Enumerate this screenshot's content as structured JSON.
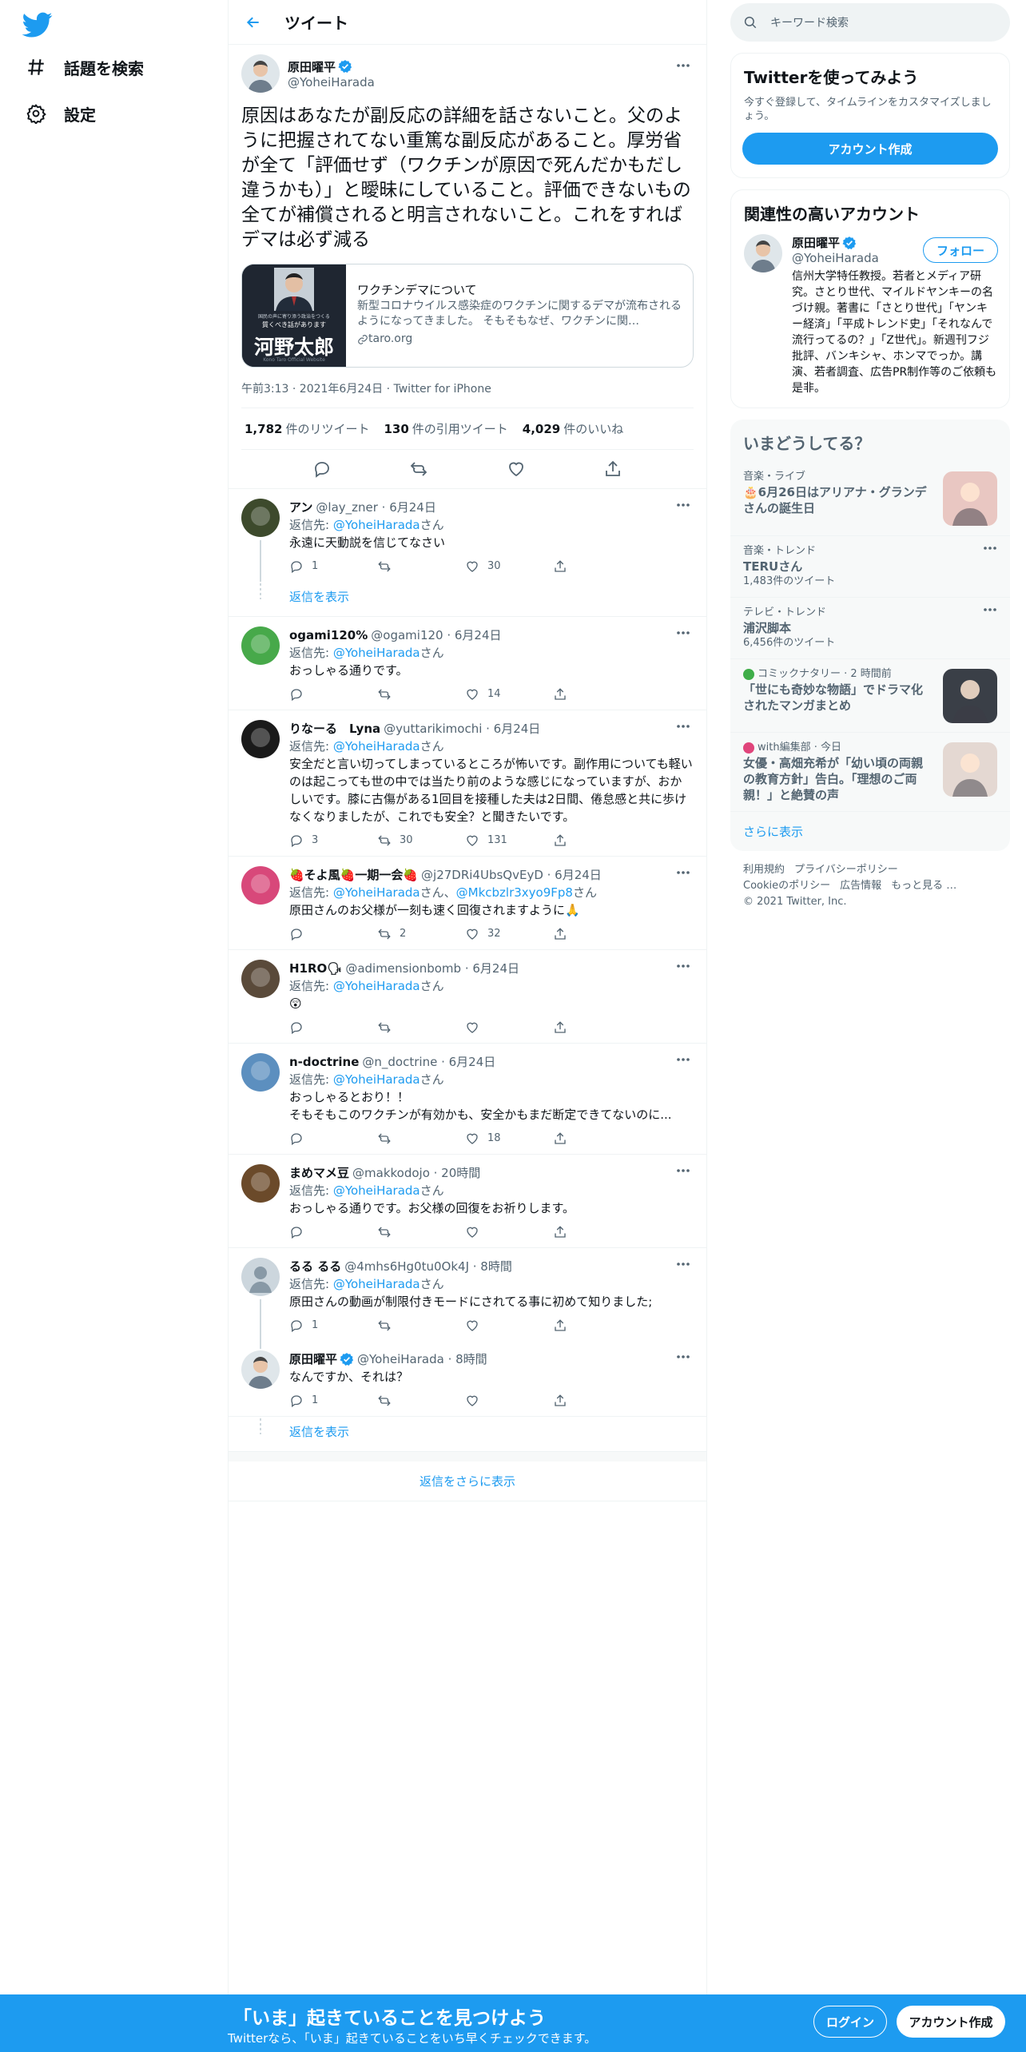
{
  "nav": {
    "logo_icon": "twitter-bird-icon",
    "items": [
      {
        "label": "話題を検索",
        "icon": "hashtag-icon"
      },
      {
        "label": "設定",
        "icon": "gear-icon"
      }
    ]
  },
  "header": {
    "title": "ツイート"
  },
  "tweet": {
    "name": "原田曜平",
    "handle": "@YoheiHarada",
    "text": "原因はあなたが副反応の詳細を話さないこと。父のように把握されてない重篤な副反応があること。厚労省が全て「評価せず（ワクチンが原因で死んだかもだし違うかも）」と曖昧にしていること。評価できないもの全てが補償されると明言されないこと。これをすればデマは必ず減る",
    "card": {
      "image_caption_small": "国民の声に寄り添う政治をつくる",
      "image_subcaption": "質くべき話があります",
      "image_name": "河野太郎",
      "image_footer": "Kono Taro Official Website",
      "title": "ワクチンデマについて",
      "description": "新型コロナウイルス感染症のワクチンに関するデマが流布されるようになってきました。 そもそもなぜ、ワクチンに関…",
      "domain": "taro.org"
    },
    "meta": "午前3:13 · 2021年6月24日 · Twitter for iPhone",
    "stats": [
      {
        "value": "1,782",
        "label": "件のリツイート"
      },
      {
        "value": "130",
        "label": "件の引用ツイート"
      },
      {
        "value": "4,029",
        "label": "件のいいね"
      }
    ]
  },
  "replies": [
    {
      "name": "アン",
      "handle": "@lay_zner · 6月24日",
      "to_prefix": "返信先: ",
      "to": [
        "@YoheiHarada"
      ],
      "to_suffix": "さん",
      "text": "永遠に天動説を信じてなさい",
      "reply_count": "1",
      "rt_count": "",
      "like_count": "30",
      "avatar_color": "#3d4a2c"
    },
    {
      "name": "ogami120%",
      "handle": "@ogami120 · 6月24日",
      "to_prefix": "返信先: ",
      "to": [
        "@YoheiHarada"
      ],
      "to_suffix": "さん",
      "text": "おっしゃる通りです。",
      "reply_count": "",
      "rt_count": "",
      "like_count": "14",
      "avatar_color": "#47a94a"
    },
    {
      "name": "りなーる　Lyna",
      "handle": "@yuttarikimochi · 6月24日",
      "to_prefix": "返信先: ",
      "to": [
        "@YoheiHarada"
      ],
      "to_suffix": "さん",
      "text": "安全だと言い切ってしまっているところが怖いです。副作用についても軽いのは起こっても世の中では当たり前のような感じになっていますが、おかしいです。膝に古傷がある1回目を接種した夫は2日間、倦怠感と共に歩けなくなりましたが、これでも安全？と聞きたいです。",
      "reply_count": "3",
      "rt_count": "30",
      "like_count": "131",
      "avatar_color": "#1a1a1a"
    },
    {
      "name": "🍓そよ風🍓一期一会🍓",
      "handle": "@j27DRi4UbsQvEyD · 6月24日",
      "to_prefix": "返信先: ",
      "to": [
        "@YoheiHarada",
        "@Mkcbzlr3xyo9Fp8"
      ],
      "to_suffix": "さん",
      "text": "原田さんのお父様が一刻も速く回復されますように🙏",
      "reply_count": "",
      "rt_count": "2",
      "like_count": "32",
      "avatar_color": "#d8487a"
    },
    {
      "name": "H1RO🗣",
      "handle": "@adimensionbomb · 6月24日",
      "to_prefix": "返信先: ",
      "to": [
        "@YoheiHarada"
      ],
      "to_suffix": "さん",
      "text": "😲",
      "reply_count": "",
      "rt_count": "",
      "like_count": "",
      "avatar_color": "#5a4a3a"
    },
    {
      "name": "n-doctrine",
      "handle": "@n_doctrine · 6月24日",
      "to_prefix": "返信先: ",
      "to": [
        "@YoheiHarada"
      ],
      "to_suffix": "さん",
      "text": "おっしゃるとおり！！\nそもそもこのワクチンが有効かも、安全かもまだ断定できてないのに...",
      "reply_count": "",
      "rt_count": "",
      "like_count": "18",
      "avatar_color": "#5c8fbf"
    },
    {
      "name": "まめマメ豆",
      "handle": "@makkodojo · 20時間",
      "to_prefix": "返信先: ",
      "to": [
        "@YoheiHarada"
      ],
      "to_suffix": "さん",
      "text": "おっしゃる通りです。お父様の回復をお祈りします。",
      "reply_count": "",
      "rt_count": "",
      "like_count": "",
      "avatar_color": "#6b4a2a"
    },
    {
      "name": "るる るる",
      "handle": "@4mhs6Hg0tu0Ok4J · 8時間",
      "to_prefix": "返信先: ",
      "to": [
        "@YoheiHarada"
      ],
      "to_suffix": "さん",
      "text": "原田さんの動画が制限付きモードにされてる事に初めて知りました;",
      "reply_count": "1",
      "rt_count": "",
      "like_count": "",
      "avatar_color": "#ccd6dd"
    },
    {
      "name": "原田曜平",
      "handle": "@YoheiHarada · 8時間",
      "to_prefix": "",
      "to": [],
      "to_suffix": "",
      "text": "なんですか、それは？",
      "reply_count": "1",
      "rt_count": "",
      "like_count": "",
      "avatar_color": "#dfe6ea"
    }
  ],
  "show_replies_label": "返信を表示",
  "show_more_replies": "返信をさらに表示",
  "right": {
    "search_placeholder": "キーワード検索",
    "signup": {
      "title": "Twitterを使ってみよう",
      "subtitle": "今すぐ登録して、タイムラインをカスタマイズしましょう。",
      "button": "アカウント作成"
    },
    "related": {
      "title": "関連性の高いアカウント",
      "name": "原田曜平",
      "handle": "@YoheiHarada",
      "follow": "フォロー",
      "bio": "信州大学特任教授。若者とメディア研究。さとり世代、マイルドヤンキーの名づけ親。著書に「さとり世代」「ヤンキー経済」「平成トレンド史」「それなんで流行ってるの？」「Z世代」。新週刊フジ批評、バンキシャ、ホンマでっか。講演、若者調査、広告PR制作等のご依頼も是非。"
    },
    "trends": {
      "title": "いまどうしてる？",
      "items": [
        {
          "category": "音楽・ライブ",
          "title": "🎂6月26日はアリアナ・グランデさんの誕生日",
          "count": "",
          "thumb": true,
          "thumb_color": "#e9c7c2"
        },
        {
          "category": "音楽・トレンド",
          "title": "TERUさん",
          "count": "1,483件のツイート",
          "thumb": false
        },
        {
          "category": "テレビ・トレンド",
          "title": "浦沢脚本",
          "count": "6,456件のツイート",
          "thumb": false
        },
        {
          "category": "コミックナタリー · 2 時間前",
          "title": "「世にも奇妙な物語」でドラマ化されたマンガまとめ",
          "count": "",
          "thumb": true,
          "thumb_color": "#3a3f47"
        },
        {
          "category": "with編集部 · 今日",
          "title": "女優・高畑充希が「幼い頃の両親の教育方針」告白。「理想のご両親！」と絶賛の声",
          "count": "",
          "thumb": true,
          "thumb_color": "#e4d8d2"
        }
      ],
      "show_more": "さらに表示"
    },
    "footer": {
      "links": [
        "利用規約",
        "プライバシーポリシー",
        "Cookieのポリシー",
        "広告情報",
        "もっと見る …"
      ],
      "copyright": "© 2021 Twitter, Inc."
    }
  },
  "bottom": {
    "title": "「いま」起きていることを見つけよう",
    "subtitle": "Twitterなら、「いま」起きていることをいち早くチェックできます。",
    "login": "ログイン",
    "signup": "アカウント作成"
  },
  "colors": {
    "accent": "#1d9bf0",
    "text": "#0f1419",
    "muted": "#536471",
    "border": "#eff3f4"
  }
}
